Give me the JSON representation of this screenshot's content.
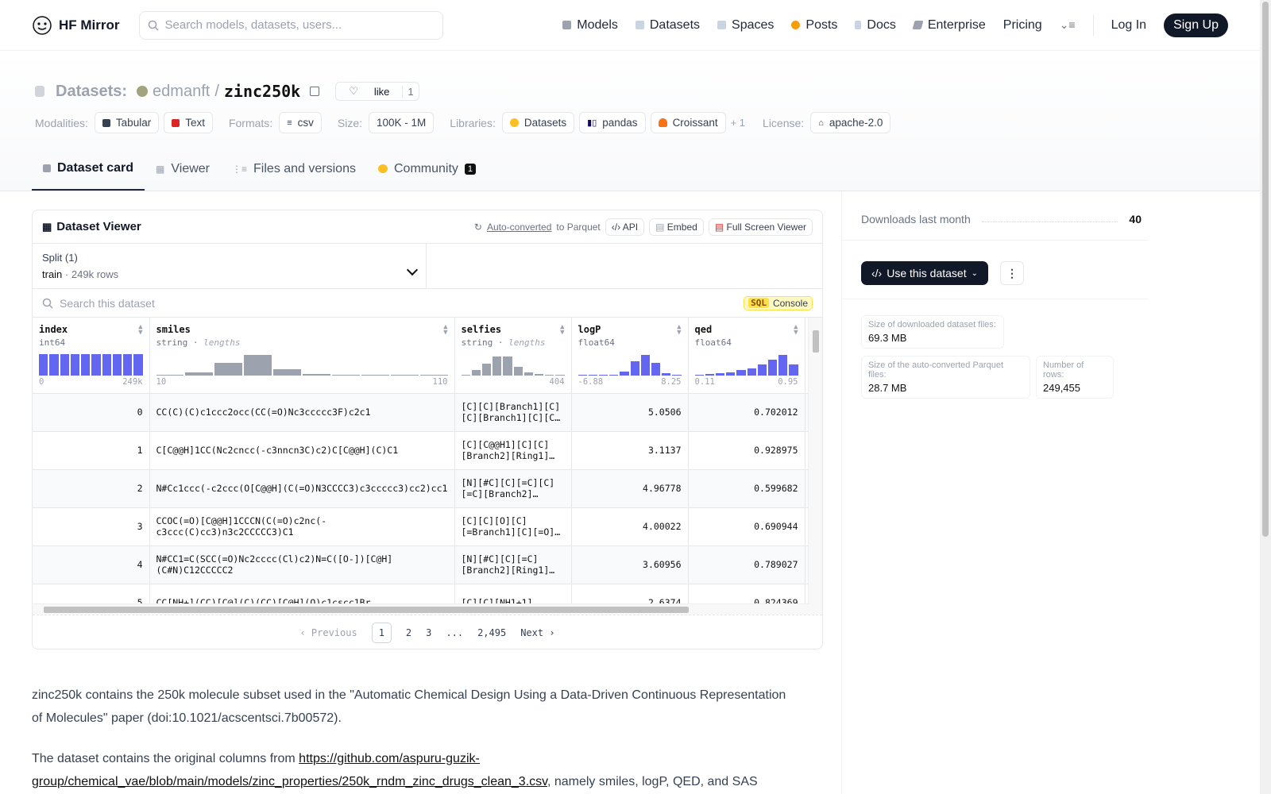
{
  "header": {
    "brand": "HF Mirror",
    "search_placeholder": "Search models, datasets, users...",
    "nav": [
      {
        "label": "Models",
        "icon": "cube-icon",
        "color": "#9ca3af"
      },
      {
        "label": "Datasets",
        "icon": "database-icon",
        "color": "#9ca3af"
      },
      {
        "label": "Spaces",
        "icon": "grid-icon",
        "color": "#9ca3af"
      },
      {
        "label": "Posts",
        "icon": "speech-bubble-icon",
        "color": "#f59e0b"
      },
      {
        "label": "Docs",
        "icon": "book-icon",
        "color": "#9ca3af"
      },
      {
        "label": "Enterprise",
        "icon": "enterprise-icon",
        "color": "#9ca3af"
      },
      {
        "label": "Pricing",
        "icon": "",
        "color": ""
      }
    ],
    "login": "Log In",
    "signup": "Sign Up"
  },
  "dataset": {
    "section": "Datasets:",
    "owner": "edmanft",
    "separator": "/",
    "name": "zinc250k",
    "like_label": "like",
    "like_count": "1",
    "tag_groups": {
      "modalities_label": "Modalities:",
      "modalities": [
        "Tabular",
        "Text"
      ],
      "formats_label": "Formats:",
      "formats": [
        "csv"
      ],
      "size_label": "Size:",
      "size": "100K - 1M",
      "libraries_label": "Libraries:",
      "libraries": [
        "Datasets",
        "pandas",
        "Croissant"
      ],
      "libraries_more": "+ 1",
      "license_label": "License:",
      "license": "apache-2.0"
    },
    "tabs": [
      {
        "label": "Dataset card",
        "active": true
      },
      {
        "label": "Viewer",
        "active": false
      },
      {
        "label": "Files and versions",
        "active": false
      },
      {
        "label": "Community",
        "active": false,
        "badge": "1"
      }
    ]
  },
  "viewer": {
    "title": "Dataset Viewer",
    "auto_converted_link": "Auto-converted",
    "auto_converted_suffix": "to Parquet",
    "api_label": "API",
    "embed_label": "Embed",
    "fullscreen_label": "Full Screen Viewer",
    "split_label": "Split (1)",
    "split_value": "train",
    "split_sep": "·",
    "split_rows": "249k rows",
    "search_placeholder": "Search this dataset",
    "sql_tag": "SQL",
    "sql_label": "Console",
    "columns": [
      {
        "name": "index",
        "type": "int64",
        "type_extra": "",
        "min": "0",
        "max": "249k",
        "hist": [
          1,
          1,
          1,
          1,
          1,
          1,
          1,
          1,
          1,
          1
        ],
        "style": "blue"
      },
      {
        "name": "smiles",
        "type": "string",
        "type_extra": "lengths",
        "min": "10",
        "max": "110",
        "hist": [
          0.05,
          0.15,
          0.6,
          0.95,
          0.3,
          0.08,
          0.04,
          0.03,
          0.03,
          0.02
        ],
        "style": "gray"
      },
      {
        "name": "selfies",
        "type": "string",
        "type_extra": "lengths",
        "min": "",
        "max": "404",
        "hist": [
          0.05,
          0.25,
          0.55,
          0.9,
          0.9,
          0.4,
          0.15,
          0.08,
          0.05,
          0.04
        ],
        "style": "gray"
      },
      {
        "name": "logP",
        "type": "float64",
        "type_extra": "",
        "min": "-6.88",
        "max": "8.25",
        "hist": [
          0.02,
          0.02,
          0.02,
          0.05,
          0.2,
          0.65,
          0.95,
          0.6,
          0.1,
          0.03
        ],
        "style": "blue"
      },
      {
        "name": "qed",
        "type": "float64",
        "type_extra": "",
        "min": "0.11",
        "max": "0.95",
        "hist": [
          0.04,
          0.06,
          0.1,
          0.15,
          0.25,
          0.35,
          0.5,
          0.75,
          0.95,
          0.5
        ],
        "style": "blue"
      }
    ],
    "rows": [
      {
        "index": "0",
        "smiles": "CC(C)(C)c1ccc2occ(CC(=O)Nc3ccccc3F)c2c1",
        "selfies": "[C][C][Branch1][C][C][Branch1][C][C…",
        "logP": "5.0506",
        "qed": "0.702012"
      },
      {
        "index": "1",
        "smiles": "C[C@@H]1CC(Nc2cncc(-c3nncn3C)c2)C[C@@H](C)C1",
        "selfies": "[C][C@@H1][C][C][Branch2][Ring1]…",
        "logP": "3.1137",
        "qed": "0.928975"
      },
      {
        "index": "2",
        "smiles": "N#Cc1ccc(-c2ccc(O[C@@H](C(=O)N3CCCC3)c3ccccc3)cc2)cc1",
        "selfies": "[N][#C][C][=C][C][=C][Branch2]…",
        "logP": "4.96778",
        "qed": "0.599682"
      },
      {
        "index": "3",
        "smiles": "CCOC(=O)[C@@H]1CCCN(C(=O)c2nc(-c3ccc(C)cc3)n3c2CCCCC3)C1",
        "selfies": "[C][C][O][C][=Branch1][C][=O]…",
        "logP": "4.00022",
        "qed": "0.690944"
      },
      {
        "index": "4",
        "smiles": "N#CC1=C(SCC(=O)Nc2cccc(Cl)c2)N=C([O-])[C@H](C#N)C12CCCCC2",
        "selfies": "[N][#C][C][=C][Branch2][Ring1]…",
        "logP": "3.60956",
        "qed": "0.789027"
      },
      {
        "index": "5",
        "smiles": "CC[NH+](CC)[C@](C)(CC)[C@H](O)c1cscc1Br",
        "selfies": "[C][C][NH1+1]",
        "logP": "2.6374",
        "qed": "0.824369"
      }
    ],
    "pager": {
      "prev": "Previous",
      "pages": [
        "1",
        "2",
        "3",
        "...",
        "2,495"
      ],
      "next": "Next"
    }
  },
  "description": {
    "p1": "zinc250k contains the 250k molecule subset used in the \"Automatic Chemical Design Using a Data-Driven Continuous Representation of Molecules\" paper (doi:10.1021/acscentsci.7b00572).",
    "p2_before": "The dataset contains the original columns from ",
    "p2_link": "https://github.com/aspuru-guzik-group/chemical_vae/blob/main/models/zinc_properties/250k_rndm_zinc_drugs_clean_3.csv",
    "p2_after": ", namely smiles, logP, QED, and SAS"
  },
  "sidebar": {
    "downloads_label": "Downloads last month",
    "downloads_value": "40",
    "use_button": "Use this dataset",
    "stats": [
      {
        "label": "Size of downloaded dataset files:",
        "value": "69.3 MB"
      },
      {
        "label": "Size of the auto-converted Parquet files:",
        "value": "28.7 MB"
      },
      {
        "label": "Number of rows:",
        "value": "249,455"
      }
    ]
  }
}
